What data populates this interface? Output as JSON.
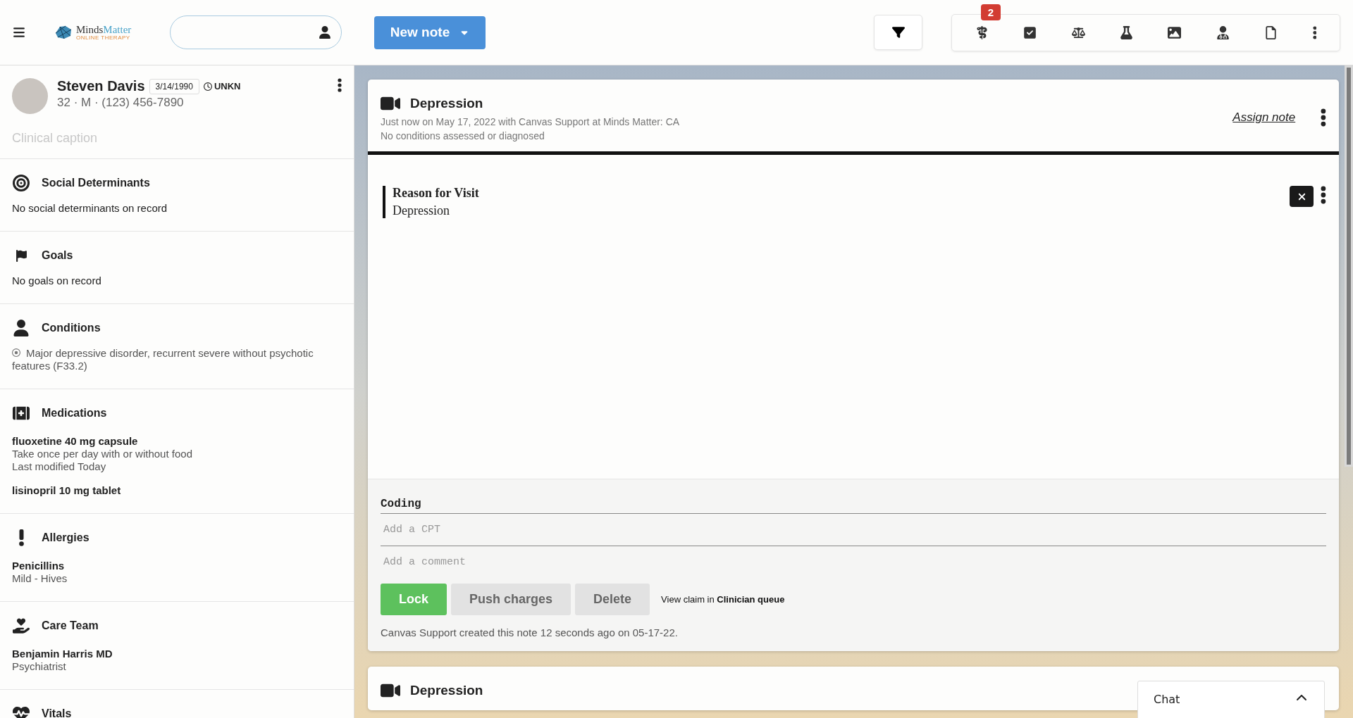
{
  "header": {
    "logo": {
      "name_part_1": "Minds",
      "name_part_2": "Matter",
      "tagline": "ONLINE THERAPY"
    },
    "new_note_button": "New note",
    "toolbar_badge": "2"
  },
  "patient": {
    "name": "Steven Davis",
    "dob": "3/14/1990",
    "time_zone": "UNKN",
    "details": "32 · M · (123) 456-7890",
    "caption_placeholder": "Clinical caption"
  },
  "sections": [
    {
      "kind": "social",
      "title": "Social Determinants",
      "items": [
        {
          "kind": "empty",
          "text": "No social determinants on record"
        }
      ]
    },
    {
      "kind": "goals",
      "title": "Goals",
      "items": [
        {
          "kind": "empty",
          "text": "No goals on record"
        }
      ]
    },
    {
      "kind": "conditions",
      "title": "Conditions",
      "items": [
        {
          "kind": "condition",
          "text": "Major depressive disorder, recurrent severe without psychotic features (F33.2)"
        }
      ]
    },
    {
      "kind": "medications",
      "title": "Medications",
      "items": [
        {
          "kind": "record",
          "title": "fluoxetine 40 mg capsule",
          "lines": [
            "Take once per day with or without food",
            "Last modified Today"
          ]
        },
        {
          "kind": "record",
          "title": "lisinopril 10 mg tablet"
        }
      ]
    },
    {
      "kind": "allergies",
      "title": "Allergies",
      "items": [
        {
          "kind": "record",
          "title": "Penicillins",
          "lines": [
            "Mild - Hives"
          ]
        }
      ]
    },
    {
      "kind": "care_team",
      "title": "Care Team",
      "items": [
        {
          "kind": "record",
          "title": "Benjamin Harris MD",
          "lines": [
            "Psychiatrist"
          ]
        }
      ]
    },
    {
      "kind": "vitals",
      "title": "Vitals"
    }
  ],
  "note": {
    "title": "Depression",
    "meta": "Just now on May 17, 2022 with Canvas Support at Minds Matter: CA",
    "conditions": "No conditions assessed or diagnosed",
    "assign_link": "Assign note",
    "command": {
      "title": "Reason for Visit",
      "value": "Depression"
    },
    "coding": {
      "label": "Coding",
      "cpt_placeholder": "Add a CPT",
      "comment_placeholder": "Add a comment"
    },
    "buttons": [
      {
        "label": "Lock",
        "kind": "primary"
      },
      {
        "label": "Push charges",
        "kind": "secondary"
      },
      {
        "label": "Delete",
        "kind": "secondary"
      }
    ],
    "claim_link": "View claim in **Clinician queue**",
    "footer": "Canvas Support created this note 12 seconds ago on 05-17-22."
  },
  "next_note": {
    "title": "Depression"
  },
  "chat": {
    "label": "Chat"
  }
}
